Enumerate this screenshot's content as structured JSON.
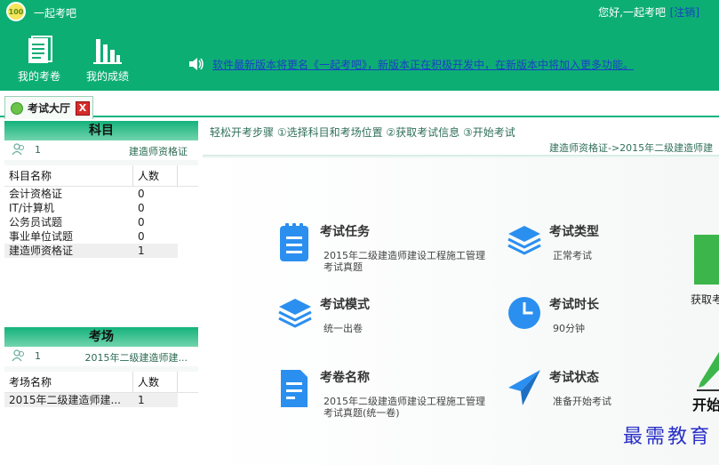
{
  "header": {
    "logo_text": "100",
    "app_title": "一起考吧",
    "greeting": "您好,一起考吧",
    "logout": "注销",
    "toolbar": {
      "my_papers": "我的考卷",
      "my_scores": "我的成绩"
    },
    "notice": "软件最新版本将更名《一起考吧》，新版本正在积极开发中，在新版本中将加入更多功能。"
  },
  "tabs": [
    {
      "label": "考试大厅",
      "close": "X"
    }
  ],
  "left": {
    "subjects": {
      "title": "科目",
      "user_count": "1",
      "current": "建造师资格证",
      "col_name": "科目名称",
      "col_count": "人数",
      "rows": [
        {
          "name": "会计资格证",
          "count": "0"
        },
        {
          "name": "IT/计算机",
          "count": "0"
        },
        {
          "name": "公务员试题",
          "count": "0"
        },
        {
          "name": "事业单位试题",
          "count": "0"
        },
        {
          "name": "建造师资格证",
          "count": "1"
        }
      ]
    },
    "rooms": {
      "title": "考场",
      "user_count": "1",
      "current": "2015年二级建造师建...",
      "col_name": "考场名称",
      "col_count": "人数",
      "rows": [
        {
          "name": "2015年二级建造师建...",
          "count": "1"
        }
      ]
    }
  },
  "main": {
    "steps": "轻松开考步骤 ①选择科目和考场位置 ②获取考试信息 ③开始考试",
    "breadcrumb": "建造师资格证->2015年二级建造师建",
    "items": {
      "task": {
        "title": "考试任务",
        "value": "2015年二级建造师建设工程施工管理考试真题"
      },
      "type": {
        "title": "考试类型",
        "value": "正常考试"
      },
      "mode": {
        "title": "考试模式",
        "value": "统一出卷"
      },
      "duration": {
        "title": "考试时长",
        "value": "90分钟"
      },
      "paper": {
        "title": "考卷名称",
        "value": "2015年二级建造师建设工程施工管理考试真题(统一卷)"
      },
      "status": {
        "title": "考试状态",
        "value": "准备开始考试"
      }
    },
    "side": {
      "fetch": "获取考",
      "start": "开始"
    }
  },
  "watermark": "最需教育",
  "colors": {
    "brand_green": "#0dae74",
    "icon_blue": "#2b8ff0",
    "link_blue": "#1b3fc7"
  }
}
